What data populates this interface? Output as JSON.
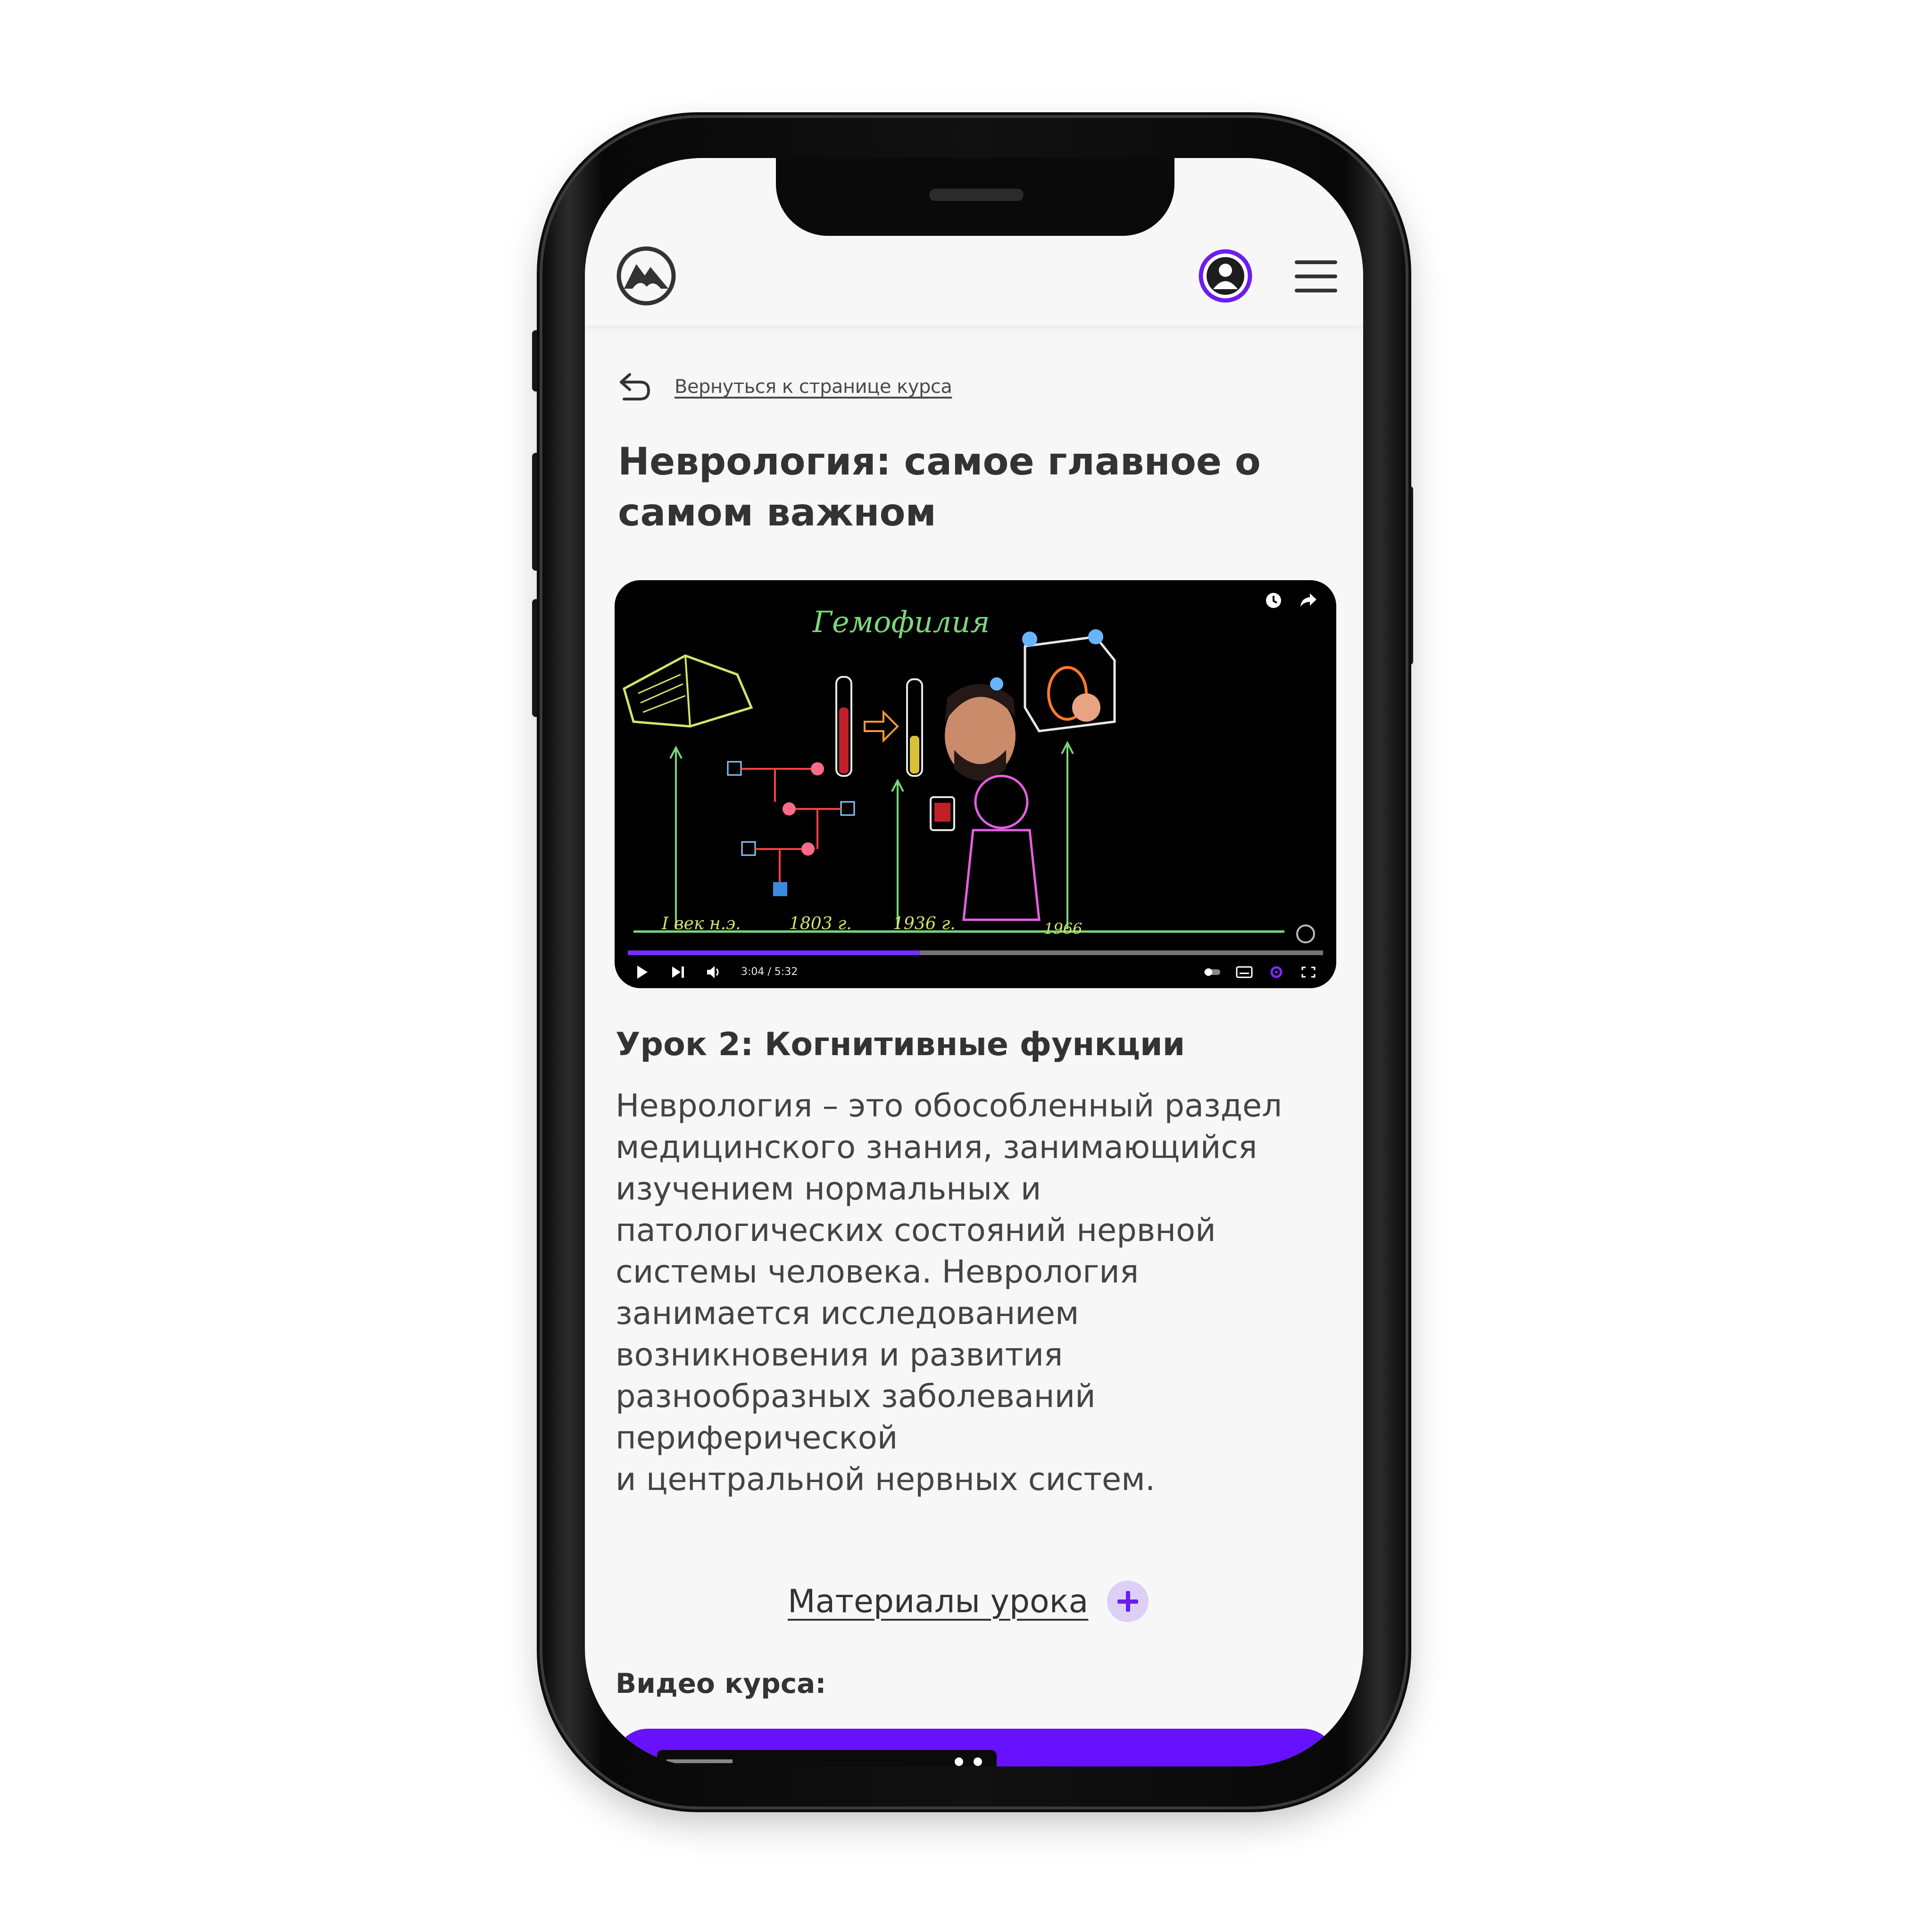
{
  "header": {
    "logo": "mountain-logo-icon",
    "profile_icon": "user-avatar-icon",
    "menu_icon": "hamburger-menu-icon",
    "accent": "#6d1cf0"
  },
  "back_link": {
    "label": "Вернуться к странице курса",
    "icon": "return-arrow-icon"
  },
  "page_title": "Неврология: самое главное о самом важном",
  "video": {
    "board_title": "Гемофилия",
    "timestamp": "3:04 / 5:32",
    "progress": 0.42,
    "progress_color": "#7a2cff",
    "timeline_labels": [
      "I век н.э.",
      "1803 г.",
      "1936 г.",
      "1966"
    ]
  },
  "lesson": {
    "title": "Урок 2: Когнитивные функции",
    "description": "Неврология – это обособленный раздел\nмедицинского знания, занимающийся\nизучением нормальных и\nпатологических состояний нервной\nсистемы человека. Неврология\nзанимается исследованием\nвозникновения и развития\nразнообразных заболеваний\nпериферической\nи центральной нервных систем."
  },
  "materials": {
    "label": "Материалы урока",
    "icon": "plus-icon"
  },
  "course_videos": {
    "title": "Видео курса:",
    "card_color": "#6611ff"
  }
}
